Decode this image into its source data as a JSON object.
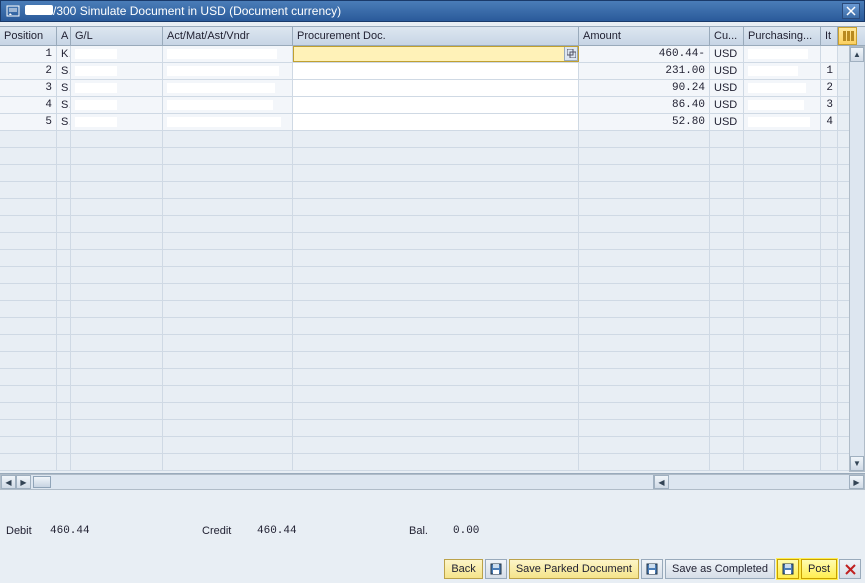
{
  "titlebar": {
    "prefix_redacted": "/300",
    "title": "Simulate Document in USD (Document currency)"
  },
  "grid": {
    "headers": {
      "position": "Position",
      "a": "A",
      "gl": "G/L",
      "act": "Act/Mat/Ast/Vndr",
      "proc": "Procurement Doc.",
      "amount": "Amount",
      "cu": "Cu...",
      "purch": "Purchasing...",
      "it": "It"
    },
    "rows": [
      {
        "pos": "1",
        "a": "K",
        "gl": "",
        "act": "",
        "proc": "",
        "amount": "460.44-",
        "cu": "USD",
        "purch": "",
        "active": true
      },
      {
        "pos": "2",
        "a": "S",
        "gl": "",
        "act": "",
        "proc": "",
        "amount": "231.00",
        "cu": "USD",
        "purch": "",
        "it": "1"
      },
      {
        "pos": "3",
        "a": "S",
        "gl": "",
        "act": "",
        "proc": "",
        "amount": "90.24",
        "cu": "USD",
        "purch": "",
        "it": "2"
      },
      {
        "pos": "4",
        "a": "S",
        "gl": "",
        "act": "",
        "proc": "",
        "amount": "86.40",
        "cu": "USD",
        "purch": "",
        "it": "3"
      },
      {
        "pos": "5",
        "a": "S",
        "gl": "",
        "act": "",
        "proc": "",
        "amount": "52.80",
        "cu": "USD",
        "purch": "",
        "it": "4"
      }
    ]
  },
  "totals": {
    "debit_label": "Debit",
    "debit": "460.44",
    "credit_label": "Credit",
    "credit": "460.44",
    "bal_label": "Bal.",
    "bal": "0.00"
  },
  "footer": {
    "back": "Back",
    "save_parked": "Save Parked Document",
    "save_completed": "Save as Completed",
    "post": "Post"
  },
  "colors": {
    "highlight": "#fff2b8",
    "titlebar": "#2a5a9a"
  }
}
